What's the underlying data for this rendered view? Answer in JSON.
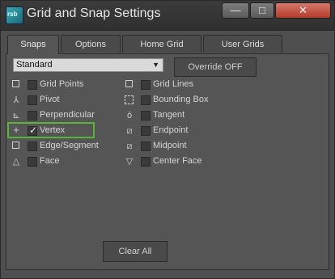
{
  "window": {
    "title": "Grid and Snap Settings",
    "icon_text": "rsb"
  },
  "titlebar_buttons": {
    "minimize": "—",
    "maximize": "□",
    "close": "✕"
  },
  "tabs": [
    {
      "label": "Snaps",
      "active": true
    },
    {
      "label": "Options",
      "active": false
    },
    {
      "label": "Home Grid",
      "active": false
    },
    {
      "label": "User Grids",
      "active": false
    }
  ],
  "preset_dropdown": {
    "value": "Standard",
    "arrow": "▼"
  },
  "override_button": "Override OFF",
  "left_snaps": [
    {
      "label": "Grid Points",
      "symbol": "square-icon",
      "checked": false
    },
    {
      "label": "Pivot",
      "symbol": "pivot-icon",
      "checked": false
    },
    {
      "label": "Perpendicular",
      "symbol": "perpendicular-icon",
      "checked": false
    },
    {
      "label": "Vertex",
      "symbol": "vertex-plus-icon",
      "checked": true
    },
    {
      "label": "Edge/Segment",
      "symbol": "square-icon",
      "checked": false
    },
    {
      "label": "Face",
      "symbol": "triangle-icon",
      "checked": false
    }
  ],
  "right_snaps": [
    {
      "label": "Grid Lines",
      "symbol": "square-icon",
      "checked": false
    },
    {
      "label": "Bounding Box",
      "symbol": "dashed-box-icon",
      "checked": false
    },
    {
      "label": "Tangent",
      "symbol": "tangent-icon",
      "checked": false
    },
    {
      "label": "Endpoint",
      "symbol": "endpoint-icon",
      "checked": false
    },
    {
      "label": "Midpoint",
      "symbol": "midpoint-icon",
      "checked": false
    },
    {
      "label": "Center Face",
      "symbol": "down-triangle-icon",
      "checked": false
    }
  ],
  "clear_all_button": "Clear All",
  "colors": {
    "highlight": "#57b53a",
    "panel": "#555555",
    "close_button": "#c44f3e"
  }
}
